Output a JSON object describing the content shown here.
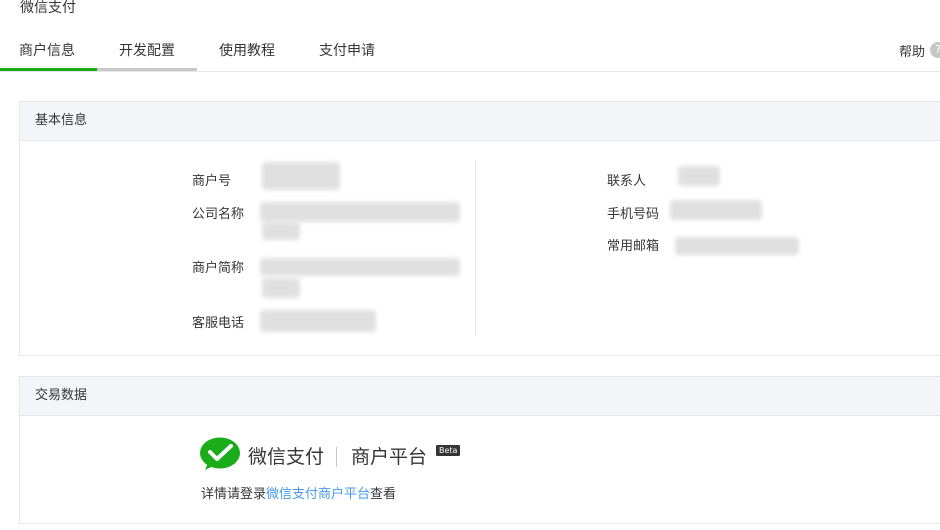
{
  "app": {
    "title": "微信支付"
  },
  "tabs": [
    {
      "label": "商户信息",
      "active": true
    },
    {
      "label": "开发配置",
      "active": false
    },
    {
      "label": "使用教程",
      "active": false
    },
    {
      "label": "支付申请",
      "active": false
    }
  ],
  "help": {
    "label": "帮助",
    "icon": "question-icon"
  },
  "basic_info": {
    "title": "基本信息",
    "left_fields": [
      {
        "label": "商户号"
      },
      {
        "label": "公司名称"
      },
      {
        "label": "商户简称"
      },
      {
        "label": "客服电话"
      }
    ],
    "right_fields": [
      {
        "label": "联系人"
      },
      {
        "label": "手机号码"
      },
      {
        "label": "常用邮箱"
      }
    ]
  },
  "trade_data": {
    "title": "交易数据",
    "logo_brand": "微信支付",
    "logo_product": "商户平台",
    "logo_badge": "Beta",
    "notice_prefix": "详情请登录",
    "notice_link": "微信支付商户平台",
    "notice_suffix": "查看"
  },
  "colors": {
    "accent": "#1aad19",
    "link": "#459ae9",
    "header_bg": "#f4f5f9"
  }
}
